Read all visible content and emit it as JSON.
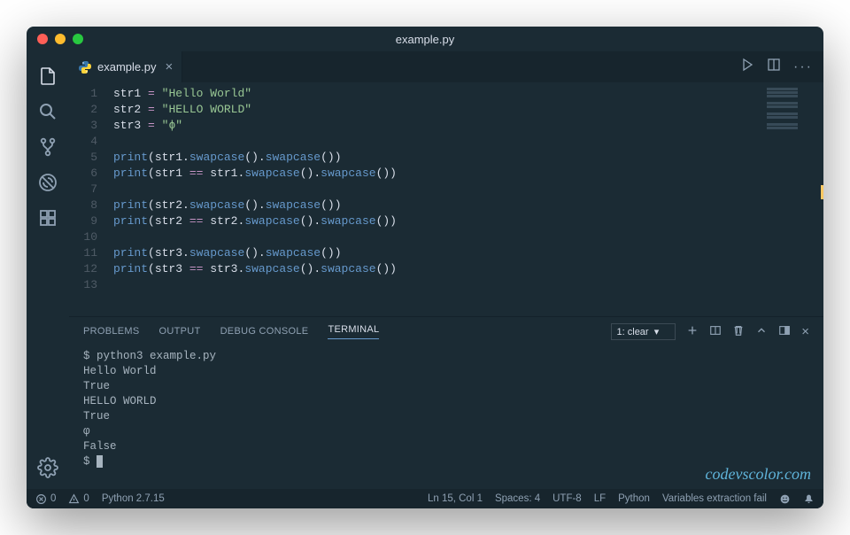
{
  "window": {
    "title": "example.py"
  },
  "tab": {
    "filename": "example.py"
  },
  "code_lines": [
    {
      "n": 1,
      "tokens": [
        [
          "tok-var",
          "str1"
        ],
        [
          "tok-p",
          " "
        ],
        [
          "tok-op",
          "="
        ],
        [
          "tok-p",
          " "
        ],
        [
          "tok-str",
          "\"Hello World\""
        ]
      ]
    },
    {
      "n": 2,
      "tokens": [
        [
          "tok-var",
          "str2"
        ],
        [
          "tok-p",
          " "
        ],
        [
          "tok-op",
          "="
        ],
        [
          "tok-p",
          " "
        ],
        [
          "tok-str",
          "\"HELLO WORLD\""
        ]
      ]
    },
    {
      "n": 3,
      "tokens": [
        [
          "tok-var",
          "str3"
        ],
        [
          "tok-p",
          " "
        ],
        [
          "tok-op",
          "="
        ],
        [
          "tok-p",
          " "
        ],
        [
          "tok-str",
          "\"ϕ\""
        ]
      ]
    },
    {
      "n": 4,
      "tokens": []
    },
    {
      "n": 5,
      "tokens": [
        [
          "tok-fn",
          "print"
        ],
        [
          "tok-p",
          "("
        ],
        [
          "tok-var",
          "str1"
        ],
        [
          "tok-p",
          "."
        ],
        [
          "tok-call",
          "swapcase"
        ],
        [
          "tok-p",
          "()."
        ],
        [
          "tok-call",
          "swapcase"
        ],
        [
          "tok-p",
          "())"
        ]
      ]
    },
    {
      "n": 6,
      "tokens": [
        [
          "tok-fn",
          "print"
        ],
        [
          "tok-p",
          "("
        ],
        [
          "tok-var",
          "str1"
        ],
        [
          "tok-p",
          " "
        ],
        [
          "tok-op",
          "=="
        ],
        [
          "tok-p",
          " "
        ],
        [
          "tok-var",
          "str1"
        ],
        [
          "tok-p",
          "."
        ],
        [
          "tok-call",
          "swapcase"
        ],
        [
          "tok-p",
          "()."
        ],
        [
          "tok-call",
          "swapcase"
        ],
        [
          "tok-p",
          "())"
        ]
      ]
    },
    {
      "n": 7,
      "tokens": []
    },
    {
      "n": 8,
      "tokens": [
        [
          "tok-fn",
          "print"
        ],
        [
          "tok-p",
          "("
        ],
        [
          "tok-var",
          "str2"
        ],
        [
          "tok-p",
          "."
        ],
        [
          "tok-call",
          "swapcase"
        ],
        [
          "tok-p",
          "()."
        ],
        [
          "tok-call",
          "swapcase"
        ],
        [
          "tok-p",
          "())"
        ]
      ]
    },
    {
      "n": 9,
      "tokens": [
        [
          "tok-fn",
          "print"
        ],
        [
          "tok-p",
          "("
        ],
        [
          "tok-var",
          "str2"
        ],
        [
          "tok-p",
          " "
        ],
        [
          "tok-op",
          "=="
        ],
        [
          "tok-p",
          " "
        ],
        [
          "tok-var",
          "str2"
        ],
        [
          "tok-p",
          "."
        ],
        [
          "tok-call",
          "swapcase"
        ],
        [
          "tok-p",
          "()."
        ],
        [
          "tok-call",
          "swapcase"
        ],
        [
          "tok-p",
          "())"
        ]
      ]
    },
    {
      "n": 10,
      "tokens": []
    },
    {
      "n": 11,
      "tokens": [
        [
          "tok-fn",
          "print"
        ],
        [
          "tok-p",
          "("
        ],
        [
          "tok-var",
          "str3"
        ],
        [
          "tok-p",
          "."
        ],
        [
          "tok-call",
          "swapcase"
        ],
        [
          "tok-p",
          "()."
        ],
        [
          "tok-call",
          "swapcase"
        ],
        [
          "tok-p",
          "())"
        ]
      ]
    },
    {
      "n": 12,
      "tokens": [
        [
          "tok-fn",
          "print"
        ],
        [
          "tok-p",
          "("
        ],
        [
          "tok-var",
          "str3"
        ],
        [
          "tok-p",
          " "
        ],
        [
          "tok-op",
          "=="
        ],
        [
          "tok-p",
          " "
        ],
        [
          "tok-var",
          "str3"
        ],
        [
          "tok-p",
          "."
        ],
        [
          "tok-call",
          "swapcase"
        ],
        [
          "tok-p",
          "()."
        ],
        [
          "tok-call",
          "swapcase"
        ],
        [
          "tok-p",
          "())"
        ]
      ]
    },
    {
      "n": 13,
      "tokens": []
    }
  ],
  "panel": {
    "tabs": {
      "problems": "PROBLEMS",
      "output": "OUTPUT",
      "debug": "DEBUG CONSOLE",
      "terminal": "TERMINAL"
    },
    "term_select": "1: clear"
  },
  "terminal_lines": [
    "$ python3 example.py",
    "Hello World",
    "True",
    "HELLO WORLD",
    "True",
    "φ",
    "False",
    "$ "
  ],
  "status": {
    "errors": "0",
    "warnings": "0",
    "python": "Python 2.7.15",
    "cursor": "Ln 15, Col 1",
    "spaces": "Spaces: 4",
    "encoding": "UTF-8",
    "eol": "LF",
    "lang": "Python",
    "msg": "Variables extraction fail"
  },
  "watermark": "codevscolor.com"
}
